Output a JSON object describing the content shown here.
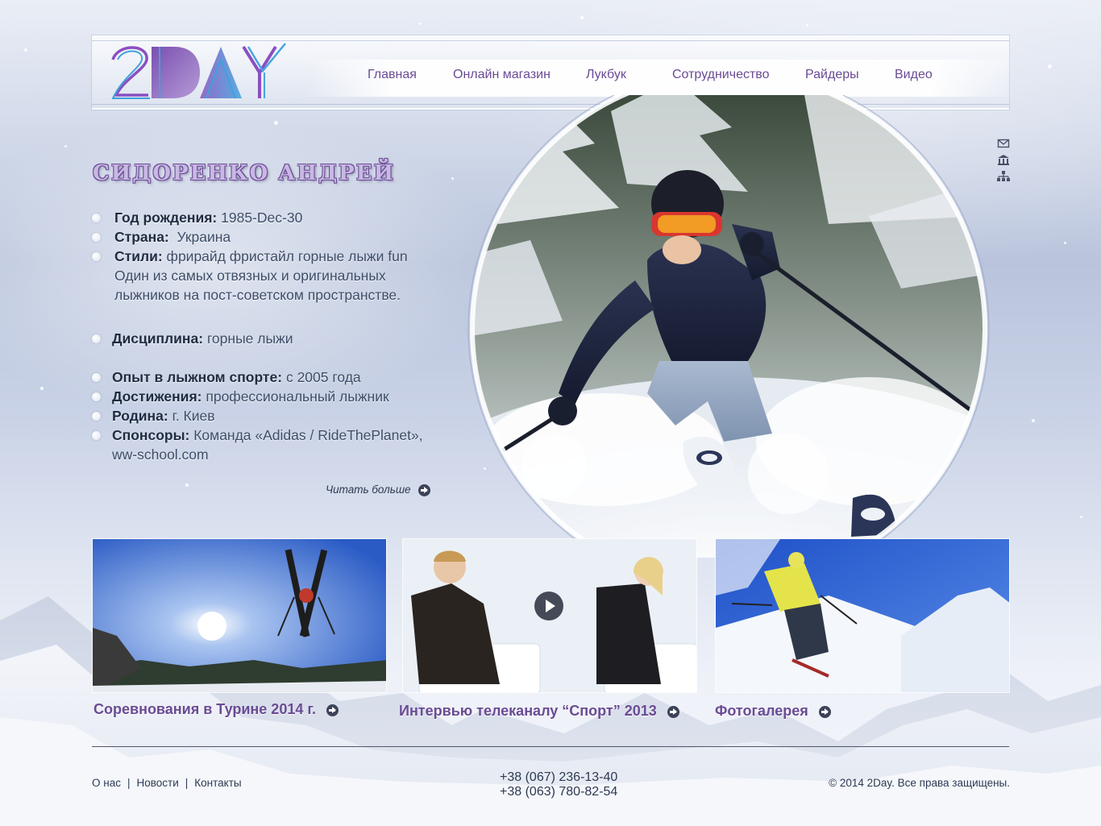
{
  "logo": {
    "text": "2DAY"
  },
  "nav": {
    "items": [
      {
        "label": "Главная"
      },
      {
        "label": "Онлайн магазин"
      },
      {
        "label": "Лукбук"
      },
      {
        "label": "Сотрудничество"
      },
      {
        "label": "Райдеры"
      },
      {
        "label": "Видео"
      }
    ]
  },
  "side_icons": [
    "mail-icon",
    "home-icon",
    "sitemap-icon"
  ],
  "profile": {
    "name": "СИДОРЕНКО АНДРЕЙ",
    "birth_label": "Год рождения:",
    "birth_value": "1985-Dec-30",
    "country_label": "Страна:",
    "country_value": "Украина",
    "styles_label": "Стили:",
    "styles_value": "фрирайд фристайл горные лыжи fun",
    "description": "Один из самых отвязных и оригинальных лыжников на пост-советском пространстве.",
    "discipline_label": "Дисциплина:",
    "discipline_value": "горные лыжи",
    "experience_label": "Опыт в лыжном спорте:",
    "experience_value": "с 2005 года",
    "achievements_label": "Достижения:",
    "achievements_value": "профессиональный лыжник",
    "homeland_label": "Родина:",
    "homeland_value": "г. Киев",
    "sponsors_label": "Спонсоры:",
    "sponsors_value": "Команда «Adidas / RideThePlanet», ww-school.com",
    "read_more": "Читать больше"
  },
  "media": [
    {
      "caption": "Соревнования в Турине 2014 г."
    },
    {
      "caption": "Интервью телеканалу “Спорт” 2013"
    },
    {
      "caption": "Фотогалерея"
    }
  ],
  "footer": {
    "links": [
      "О нас",
      "Новости",
      "Контакты"
    ],
    "phones": [
      "+38 (067) 236-13-40",
      "+38 (063) 780-82-54"
    ],
    "copyright": "© 2014 2Day. Все права защищены."
  },
  "colors": {
    "accent": "#6a4b94",
    "text": "#3e4d68",
    "dark": "#1f2b40"
  }
}
